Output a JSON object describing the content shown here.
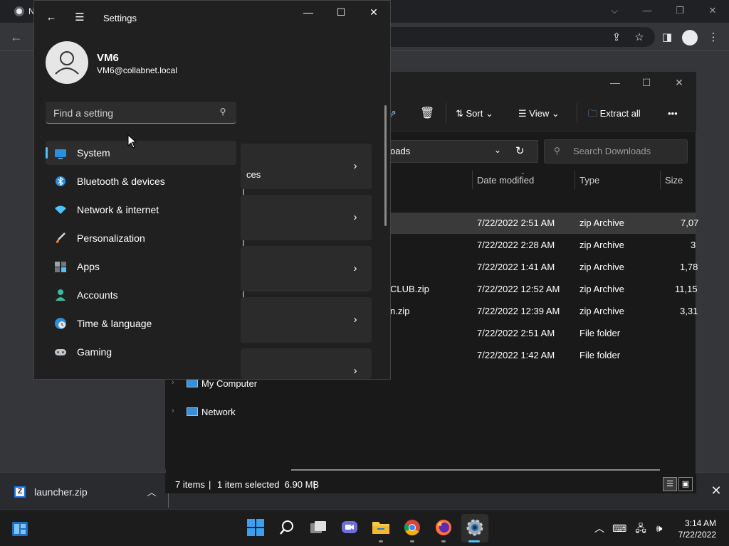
{
  "chrome": {
    "tab_title": "N",
    "controls": {
      "dropdown": "⌵",
      "minimize": "—",
      "restore": "❐",
      "close": "✕"
    },
    "toolbar_icons": [
      "share-icon",
      "star-icon",
      "sidepanel-icon",
      "profile-icon",
      "menu-icon"
    ]
  },
  "download_bar": {
    "file_name": "launcher.zip",
    "icon_letter": "Z"
  },
  "explorer": {
    "toolbar": {
      "sort_label": "Sort",
      "view_label": "View",
      "extract_label": "Extract all",
      "more_label": "•••"
    },
    "address_fragment": "oads",
    "search_placeholder": "Search Downloads",
    "columns": {
      "date": "Date modified",
      "type": "Type",
      "size": "Size"
    },
    "rows": [
      {
        "name": "",
        "date": "7/22/2022 2:51 AM",
        "type": "zip Archive",
        "size": "7,07"
      },
      {
        "name": "",
        "date": "7/22/2022 2:28 AM",
        "type": "zip Archive",
        "size": "3"
      },
      {
        "name": "",
        "date": "7/22/2022 1:41 AM",
        "type": "zip Archive",
        "size": "1,78"
      },
      {
        "name": "CLUB.zip",
        "date": "7/22/2022 12:52 AM",
        "type": "zip Archive",
        "size": "11,15"
      },
      {
        "name": "n.zip",
        "date": "7/22/2022 12:39 AM",
        "type": "zip Archive",
        "size": "3,31"
      },
      {
        "name": "",
        "date": "7/22/2022 2:51 AM",
        "type": "File folder",
        "size": ""
      },
      {
        "name": "",
        "date": "7/22/2022 1:42 AM",
        "type": "File folder",
        "size": ""
      }
    ],
    "nav": {
      "my_computer": "My Computer",
      "network": "Network"
    },
    "status": {
      "items": "7 items",
      "selected": "1 item selected  6.90 MB"
    }
  },
  "settings": {
    "title": "Settings",
    "user": {
      "name": "VM6",
      "email": "VM6@collabnet.local"
    },
    "search_placeholder": "Find a setting",
    "nav": [
      {
        "label": "System",
        "icon": "system-icon"
      },
      {
        "label": "Bluetooth & devices",
        "icon": "bluetooth-icon"
      },
      {
        "label": "Network & internet",
        "icon": "wifi-icon"
      },
      {
        "label": "Personalization",
        "icon": "brush-icon"
      },
      {
        "label": "Apps",
        "icon": "apps-icon"
      },
      {
        "label": "Accounts",
        "icon": "accounts-icon"
      },
      {
        "label": "Time & language",
        "icon": "globe-clock-icon"
      },
      {
        "label": "Gaming",
        "icon": "gamepad-icon"
      }
    ],
    "card_fragment": "ces"
  },
  "taskbar": {
    "time": "3:14 AM",
    "date": "7/22/2022"
  },
  "colors": {
    "accent": "#4cc2ff",
    "settings_bg": "#202020",
    "explorer_bg": "#191919",
    "taskbar_bg": "#1c1c1c"
  }
}
